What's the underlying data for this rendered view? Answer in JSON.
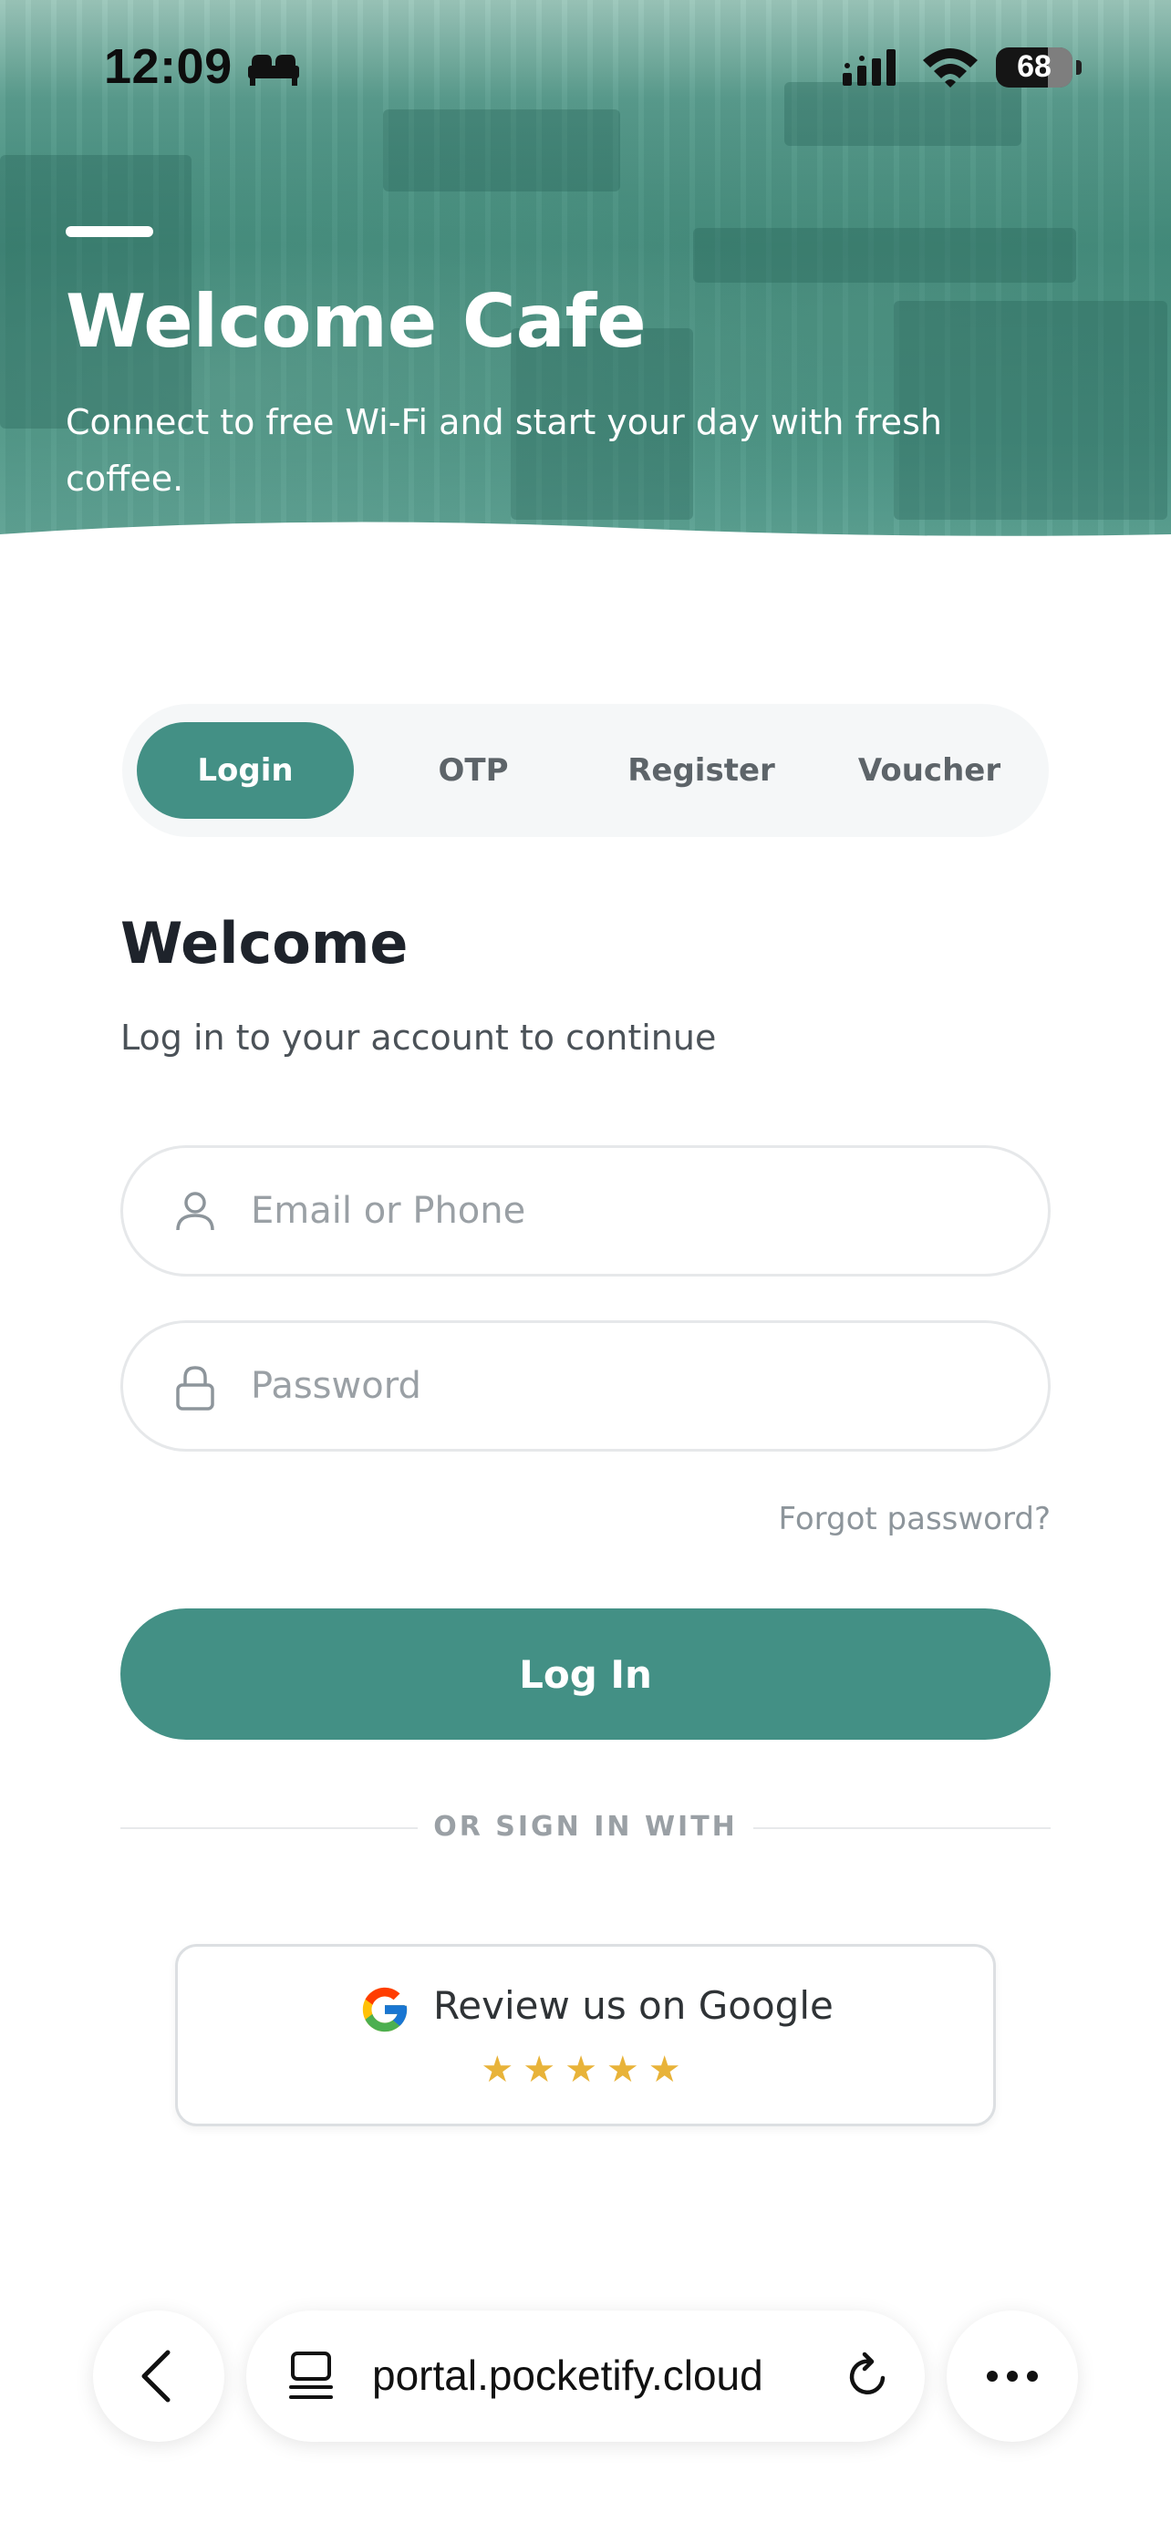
{
  "status_bar": {
    "time": "12:09",
    "battery": "68",
    "icons": [
      "bed-icon",
      "signal-icon",
      "wifi-icon",
      "battery-icon"
    ]
  },
  "hero": {
    "title": "Welcome Cafe",
    "subtitle": "Connect to free Wi-Fi and start your day with fresh coffee."
  },
  "tabs": [
    {
      "label": "Login",
      "active": true
    },
    {
      "label": "OTP",
      "active": false
    },
    {
      "label": "Register",
      "active": false
    },
    {
      "label": "Voucher",
      "active": false
    }
  ],
  "form": {
    "title": "Welcome",
    "subtitle": "Log in to your account to continue",
    "email": {
      "placeholder": "Email or Phone",
      "value": "",
      "icon": "user-icon"
    },
    "password": {
      "placeholder": "Password",
      "value": "",
      "icon": "lock-icon"
    },
    "forgot_label": "Forgot password?",
    "submit_label": "Log In",
    "divider_label": "OR SIGN IN WITH"
  },
  "google_review": {
    "label": "Review us on Google",
    "icon": "google-icon",
    "stars": "★★★★★",
    "rating": 5,
    "star_color": "#e8b339"
  },
  "browser": {
    "url": "portal.pocketify.cloud",
    "icons": [
      "back-icon",
      "tabs-icon",
      "reload-icon",
      "more-icon"
    ]
  },
  "colors": {
    "accent": "#439085",
    "title_text": "#1e232b"
  }
}
